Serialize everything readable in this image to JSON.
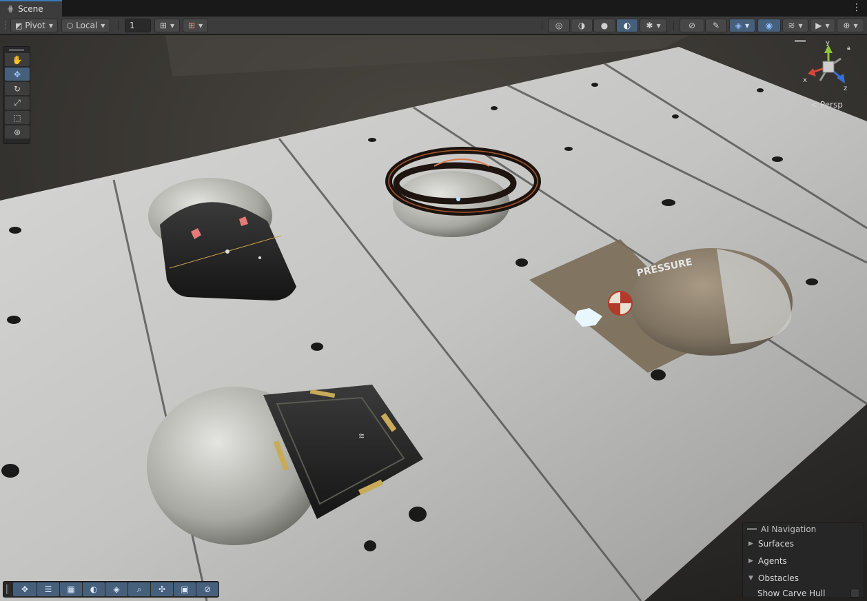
{
  "tab": {
    "icon": "grid-icon",
    "label": "Scene"
  },
  "toolbar": {
    "pivot_label": "Pivot",
    "local_label": "Local",
    "grid_size_value": "1"
  },
  "gizmo": {
    "x_label": "x",
    "y_label": "y",
    "z_label": "z",
    "projection_label": "< Persp",
    "x_color": "#d8473a",
    "y_color": "#8cc43c",
    "z_color": "#3b6fd8"
  },
  "ai_navigation": {
    "title": "AI Navigation",
    "sections": [
      {
        "label": "Surfaces",
        "expanded": false
      },
      {
        "label": "Agents",
        "expanded": false
      },
      {
        "label": "Obstacles",
        "expanded": true
      }
    ],
    "show_carve_hull_label": "Show Carve Hull",
    "show_carve_hull_checked": false
  },
  "colors": {
    "accent_active": "#46607c",
    "tab_highlight": "#3a79bb",
    "toolbar_bg": "#3c3c3c"
  }
}
